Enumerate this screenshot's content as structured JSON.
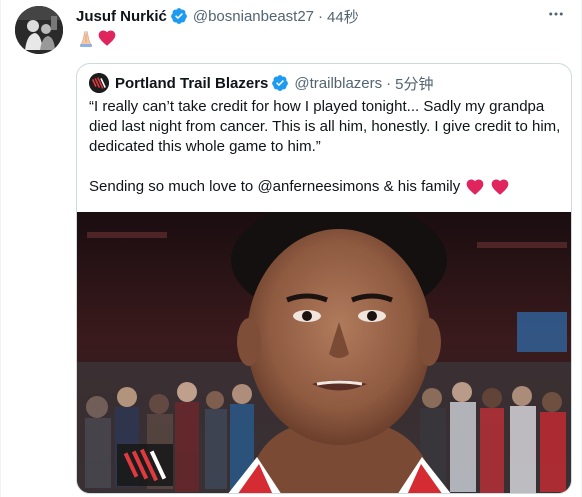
{
  "tweet": {
    "author_name": "Jusuf Nurkić",
    "author_handle": "@bosnianbeast27",
    "time": "44秒",
    "avatar_icon": "profile-photo",
    "verified_icon": "verified-badge-icon",
    "more_icon": "more-options-icon",
    "body_emojis": [
      "folded-hands-icon",
      "red-heart-icon"
    ]
  },
  "quoted": {
    "author_name": "Portland Trail Blazers",
    "author_handle": "@trailblazers",
    "time": "5分钟",
    "logo_icon": "trail-blazers-logo",
    "text_line1": "“I really can’t take credit for how I played tonight... Sadly my grandpa died last night from cancer. This is all him, honestly. I give credit to him, dedicated this whole game to him.”",
    "text_line2_prefix": "Sending so much love to ",
    "text_line2_mention": "@anferneesimons",
    "text_line2_suffix": " & his family",
    "media_description_icon": "player-interview-photo"
  },
  "colors": {
    "verified_blue": "#1d9bf0",
    "heart_red": "#e0245e",
    "secondary_text": "#536471",
    "border": "#cfd9de"
  }
}
